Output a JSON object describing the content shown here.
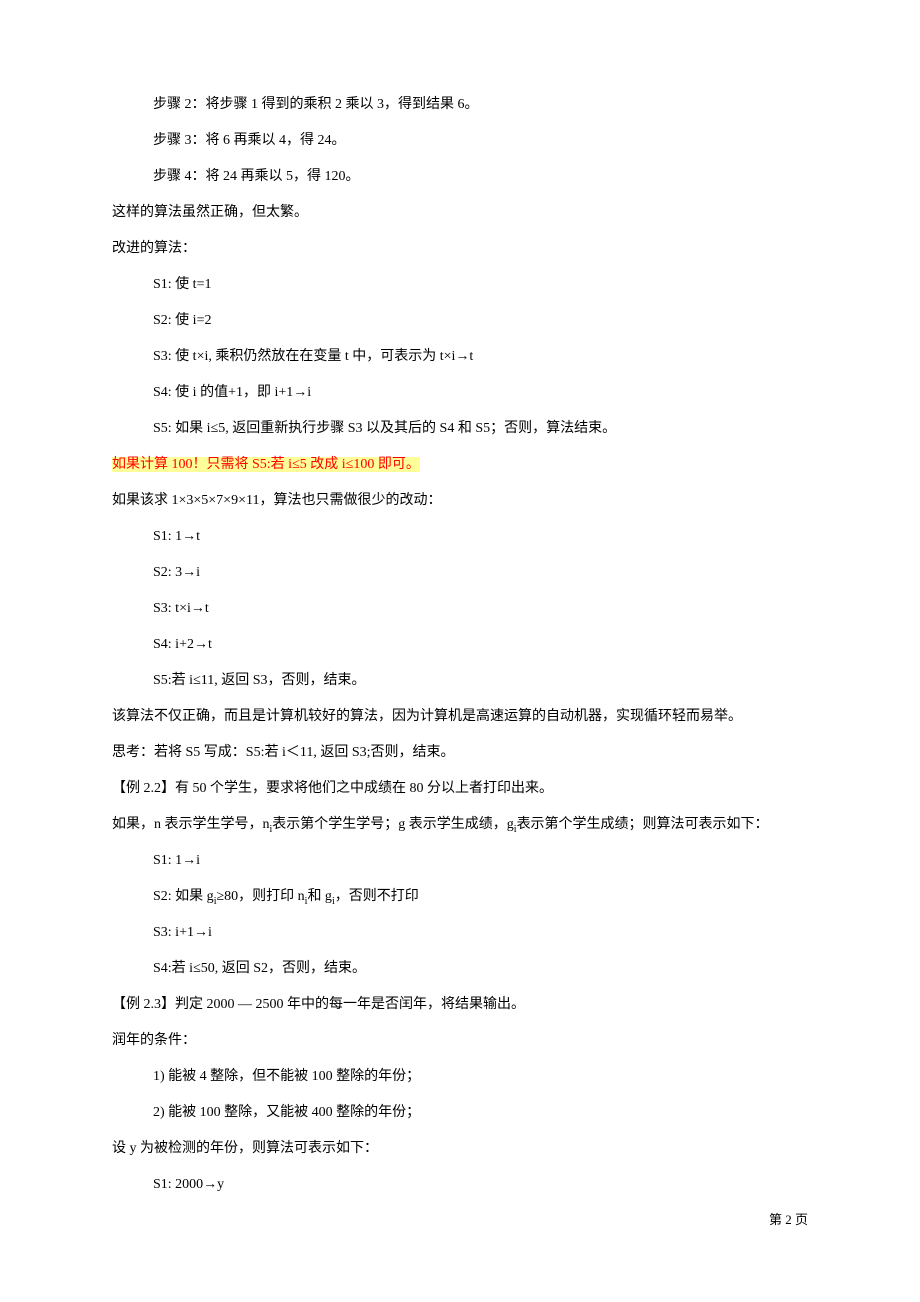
{
  "lines": {
    "p1": "步骤 2：将步骤 1 得到的乘积 2 乘以 3，得到结果 6。",
    "p2": "步骤 3：将 6 再乘以 4，得 24。",
    "p3": "步骤 4：将 24 再乘以 5，得 120。",
    "p4": "这样的算法虽然正确，但太繁。",
    "p5": "改进的算法：",
    "p6": "S1:  使 t=1",
    "p7": "S2:  使 i=2",
    "p8": "S3:  使 t×i,  乘积仍然放在在变量 t 中，可表示为 t×i→t",
    "p9": "S4:  使 i 的值+1，即 i+1→i",
    "p10": "S5:  如果 i≤5,  返回重新执行步骤 S3 以及其后的 S4 和 S5；否则，算法结束。",
    "p11": "如果计算 100！只需将 S5:若 i≤5 改成 i≤100 即可。",
    "p12": "如果该求 1×3×5×7×9×11，算法也只需做很少的改动：",
    "p13": "S1: 1→t",
    "p14": "S2: 3→i",
    "p15": "S3: t×i→t",
    "p16": "S4: i+2→t",
    "p17": "S5:若 i≤11,  返回 S3，否则，结束。",
    "p18": "该算法不仅正确，而且是计算机较好的算法，因为计算机是高速运算的自动机器，实现循环轻而易举。",
    "p19": "思考：若将 S5 写成：S5:若 i＜11,  返回 S3;否则，结束。",
    "p20": "【例 2.2】有 50 个学生，要求将他们之中成绩在 80 分以上者打印出来。",
    "p21_a": "如果，n 表示学生学号，n",
    "p21_b": "表示第个学生学号；g 表示学生成绩，g",
    "p21_c": "表示第个学生成绩；则算法可表示如下：",
    "p22": "S1: 1→i",
    "p23_a": "S2:  如果 g",
    "p23_b": "≥80，则打印 n",
    "p23_c": "和 g",
    "p23_d": "，否则不打印",
    "p24": "S3: i+1→i",
    "p25": "S4:若 i≤50,  返回 S2，否则，结束。",
    "p26": "【例 2.3】判定 2000 — 2500 年中的每一年是否闰年，将结果输出。",
    "p27": "润年的条件：",
    "p28": "1)    能被 4 整除，但不能被 100 整除的年份；",
    "p29": "2)    能被 100 整除，又能被 400 整除的年份；",
    "p30": "设 y 为被检测的年份，则算法可表示如下：",
    "p31": "S1: 2000→y",
    "sub_i": "i"
  },
  "footer": "第 2 页"
}
